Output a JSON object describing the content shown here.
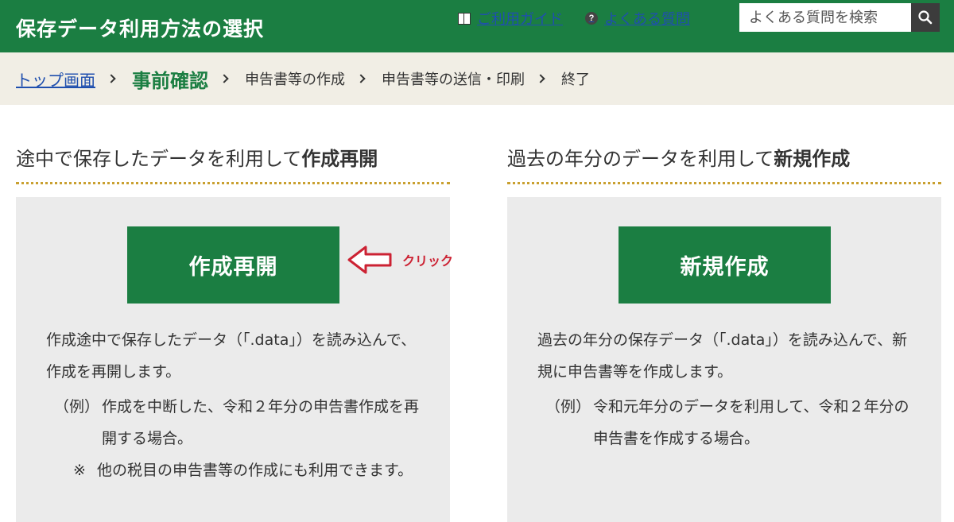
{
  "header": {
    "title": "保存データ利用方法の選択",
    "guide_link": "ご利用ガイド",
    "faq_link": "よくある質問",
    "faq_icon_text": "?",
    "search_placeholder": "よくある質問を検索",
    "icons": {
      "guide": "book-icon",
      "faq": "question-circle-icon",
      "search": "search-icon"
    },
    "bg_color": "#1b7e42"
  },
  "breadcrumb": {
    "items": [
      "トップ画面",
      "事前確認",
      "申告書等の作成",
      "申告書等の送信・印刷",
      "終了"
    ],
    "current_index": 1
  },
  "left_section": {
    "heading_prefix": "途中で保存したデータを利用して",
    "heading_bold": "作成再開",
    "button_label": "作成再開",
    "description": "作成途中で保存したデータ（「.data」）を読み込んで、作成を再開します。",
    "example_label": "（例）",
    "example_text": "作成を中断した、令和２年分の申告書作成を再開する場合。",
    "note_mark": "※",
    "note_text": "他の税目の申告書等の作成にも利用できます。"
  },
  "right_section": {
    "heading_prefix": "過去の年分のデータを利用して",
    "heading_bold": "新規作成",
    "button_label": "新規作成",
    "description": "過去の年分の保存データ（「.data」）を読み込んで、新規に申告書等を作成します。",
    "example_label": "（例）",
    "example_text": "令和元年分のデータを利用して、令和２年分の申告書を作成する場合。"
  },
  "annotation": {
    "label": "クリック",
    "icon": "arrow-left-icon",
    "color": "#cc2233"
  }
}
